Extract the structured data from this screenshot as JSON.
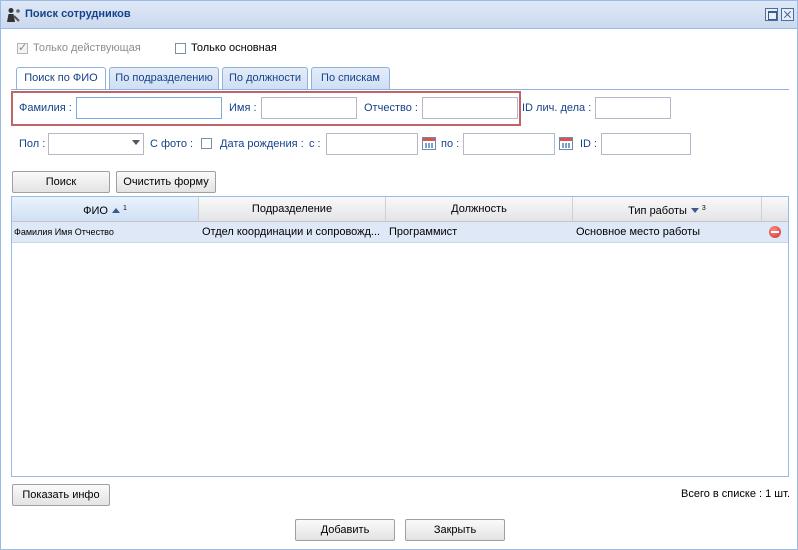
{
  "window": {
    "title": "Поиск сотрудников"
  },
  "filters": {
    "only_active_label": "Только действующая",
    "only_active_checked": true,
    "only_main_label": "Только основная",
    "only_main_checked": false
  },
  "tabs": [
    {
      "label": "Поиск по ФИО",
      "active": true
    },
    {
      "label": "По подразделению",
      "active": false
    },
    {
      "label": "По должности",
      "active": false
    },
    {
      "label": "По спискам",
      "active": false
    }
  ],
  "form": {
    "surname_label": "Фамилия :",
    "surname_value": "",
    "name_label": "Имя :",
    "name_value": "",
    "patronymic_label": "Отчество :",
    "patronymic_value": "",
    "personal_file_label": "ID лич. дела :",
    "personal_file_value": "",
    "gender_label": "Пол :",
    "gender_value": "",
    "photo_label": "С фото :",
    "birth_label": "Дата рождения :",
    "from_label": "с :",
    "from_value": "",
    "to_label": "по :",
    "to_value": "",
    "id_label": "ID :",
    "id_value": ""
  },
  "actions": {
    "search": "Поиск",
    "clear": "Очистить форму"
  },
  "grid": {
    "columns": [
      {
        "label": "ФИО",
        "sort": "asc",
        "order": "1"
      },
      {
        "label": "Подразделение",
        "sort": "",
        "order": ""
      },
      {
        "label": "Должность",
        "sort": "",
        "order": ""
      },
      {
        "label": "Тип работы",
        "sort": "desc",
        "order": "3"
      }
    ],
    "rows": [
      {
        "fio": "Фамилия Имя Отчество",
        "department": "Отдел координации и сопровожд...",
        "position": "Программист",
        "work_type": "Основное место работы"
      }
    ]
  },
  "bottom": {
    "show_info": "Показать инфо",
    "total": "Всего в списке : 1 шт."
  },
  "dialog": {
    "add": "Добавить",
    "close": "Закрыть"
  }
}
